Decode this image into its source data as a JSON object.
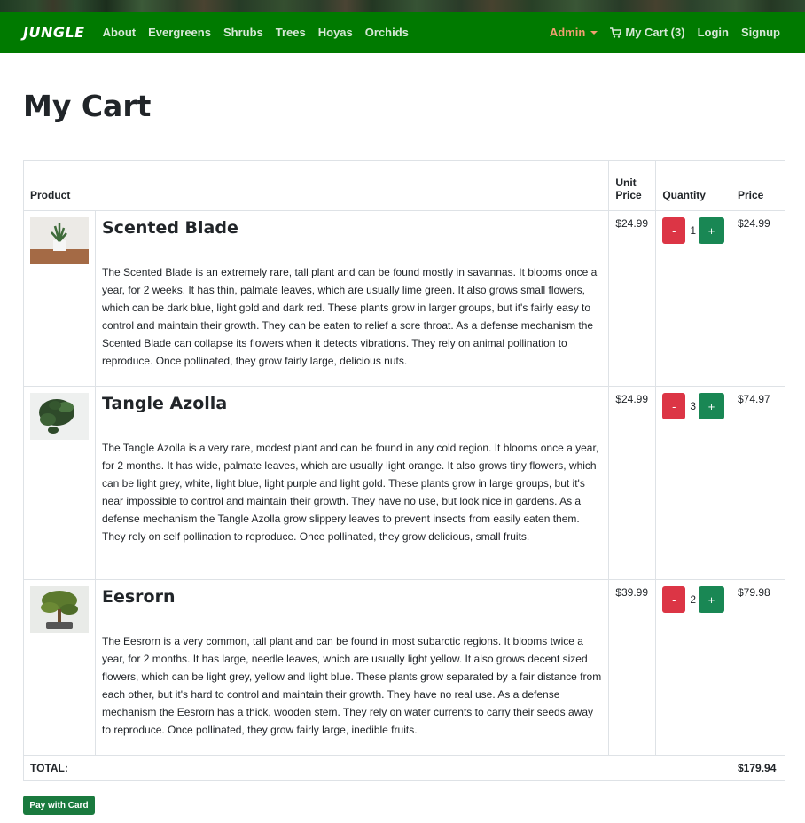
{
  "nav": {
    "brand": "JUNGLE",
    "links": [
      "About",
      "Evergreens",
      "Shrubs",
      "Trees",
      "Hoyas",
      "Orchids"
    ],
    "admin": "Admin",
    "cart": "My Cart (3)",
    "login": "Login",
    "signup": "Signup"
  },
  "page": {
    "title": "My Cart"
  },
  "table": {
    "headers": {
      "product": "Product",
      "unit_price": "Unit Price",
      "quantity": "Quantity",
      "price": "Price"
    },
    "rows": [
      {
        "name": "Scented Blade",
        "description": "The Scented Blade is an extremely rare, tall plant and can be found mostly in savannas. It blooms once a year, for 2 weeks. It has thin, palmate leaves, which are usually lime green. It also grows small flowers, which can be dark blue, light gold and dark red. These plants grow in larger groups, but it's fairly easy to control and maintain their growth. They can be eaten to relief a sore throat. As a defense mechanism the Scented Blade can collapse its flowers when it detects vibrations. They rely on animal pollination to reproduce. Once pollinated, they grow fairly large, delicious nuts.",
        "unit_price": "$24.99",
        "quantity": "1",
        "price": "$24.99",
        "minus": "-",
        "plus": "+"
      },
      {
        "name": "Tangle Azolla",
        "description": "The Tangle Azolla is a very rare, modest plant and can be found in any cold region. It blooms once a year, for 2 months. It has wide, palmate leaves, which are usually light orange. It also grows tiny flowers, which can be light grey, white, light blue, light purple and light gold. These plants grow in large groups, but it's near impossible to control and maintain their growth. They have no use, but look nice in gardens. As a defense mechanism the Tangle Azolla grow slippery leaves to prevent insects from easily eaten them. They rely on self pollination to reproduce. Once pollinated, they grow delicious, small fruits.",
        "unit_price": "$24.99",
        "quantity": "3",
        "price": "$74.97",
        "minus": "-",
        "plus": "+"
      },
      {
        "name": "Eesrorn",
        "description": "The Eesrorn is a very common, tall plant and can be found in most subarctic regions. It blooms twice a year, for 2 months. It has large, needle leaves, which are usually light yellow. It also grows decent sized flowers, which can be light grey, yellow and light blue. These plants grow separated by a fair distance from each other, but it's hard to control and maintain their growth. They have no real use. As a defense mechanism the Eesrorn has a thick, wooden stem. They rely on water currents to carry their seeds away to reproduce. Once pollinated, they grow fairly large, inedible fruits.",
        "unit_price": "$39.99",
        "quantity": "2",
        "price": "$79.98",
        "minus": "-",
        "plus": "+"
      }
    ],
    "total_label": "TOTAL:",
    "total": "$179.94"
  },
  "pay_button": "Pay with Card",
  "colors": {
    "navbar": "#007a00",
    "admin": "#f0a070",
    "minus_button": "#dc3545",
    "plus_button": "#198754",
    "pay_button": "#1a7a3e"
  },
  "icons": {
    "cart": "cart-icon"
  }
}
